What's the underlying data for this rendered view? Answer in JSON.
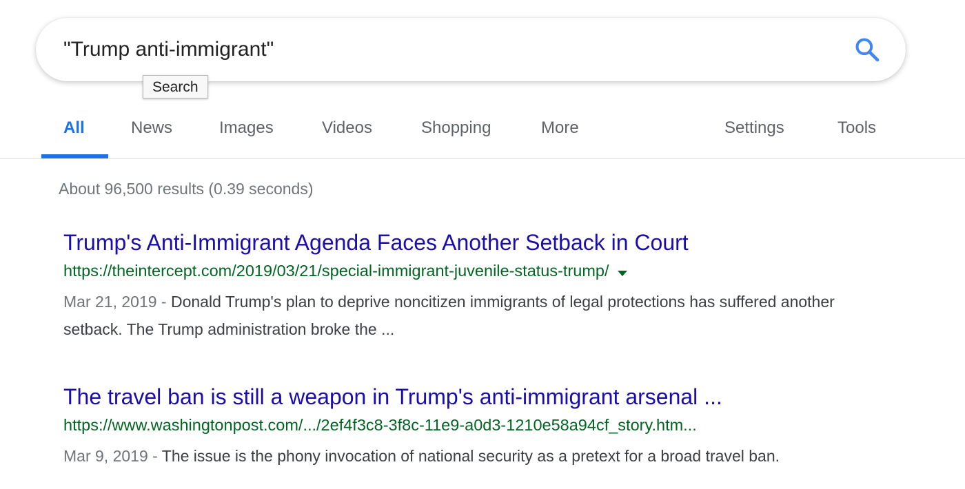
{
  "search": {
    "query": "\"Trump anti-immigrant\"",
    "icon": "search-icon",
    "tooltip": "Search"
  },
  "tabs": [
    {
      "label": "All",
      "active": true
    },
    {
      "label": "News"
    },
    {
      "label": "Images"
    },
    {
      "label": "Videos"
    },
    {
      "label": "Shopping"
    },
    {
      "label": "More"
    },
    {
      "label": "Settings"
    },
    {
      "label": "Tools"
    }
  ],
  "result_stats": "About 96,500 results (0.39 seconds)",
  "results": [
    {
      "title": "Trump's Anti-Immigrant Agenda Faces Another Setback in Court",
      "url": "https://theintercept.com/2019/03/21/special-immigrant-juvenile-status-trump/",
      "date": "Mar 21, 2019 - ",
      "snippet": "Donald Trump's plan to deprive noncitizen immigrants of legal protections has suffered another setback. The Trump administration broke the ..."
    },
    {
      "title": "The travel ban is still a weapon in Trump's anti-immigrant arsenal ...",
      "url": "https://www.washingtonpost.com/.../2ef4f3c8-3f8c-11e9-a0d3-1210e58a94cf_story.htm...",
      "date": "Mar 9, 2019 - ",
      "snippet": "The issue is the phony invocation of national security as a pretext for a broad travel ban."
    }
  ],
  "colors": {
    "accent": "#1a73e8",
    "link": "#1a0dab",
    "url": "#006621"
  }
}
